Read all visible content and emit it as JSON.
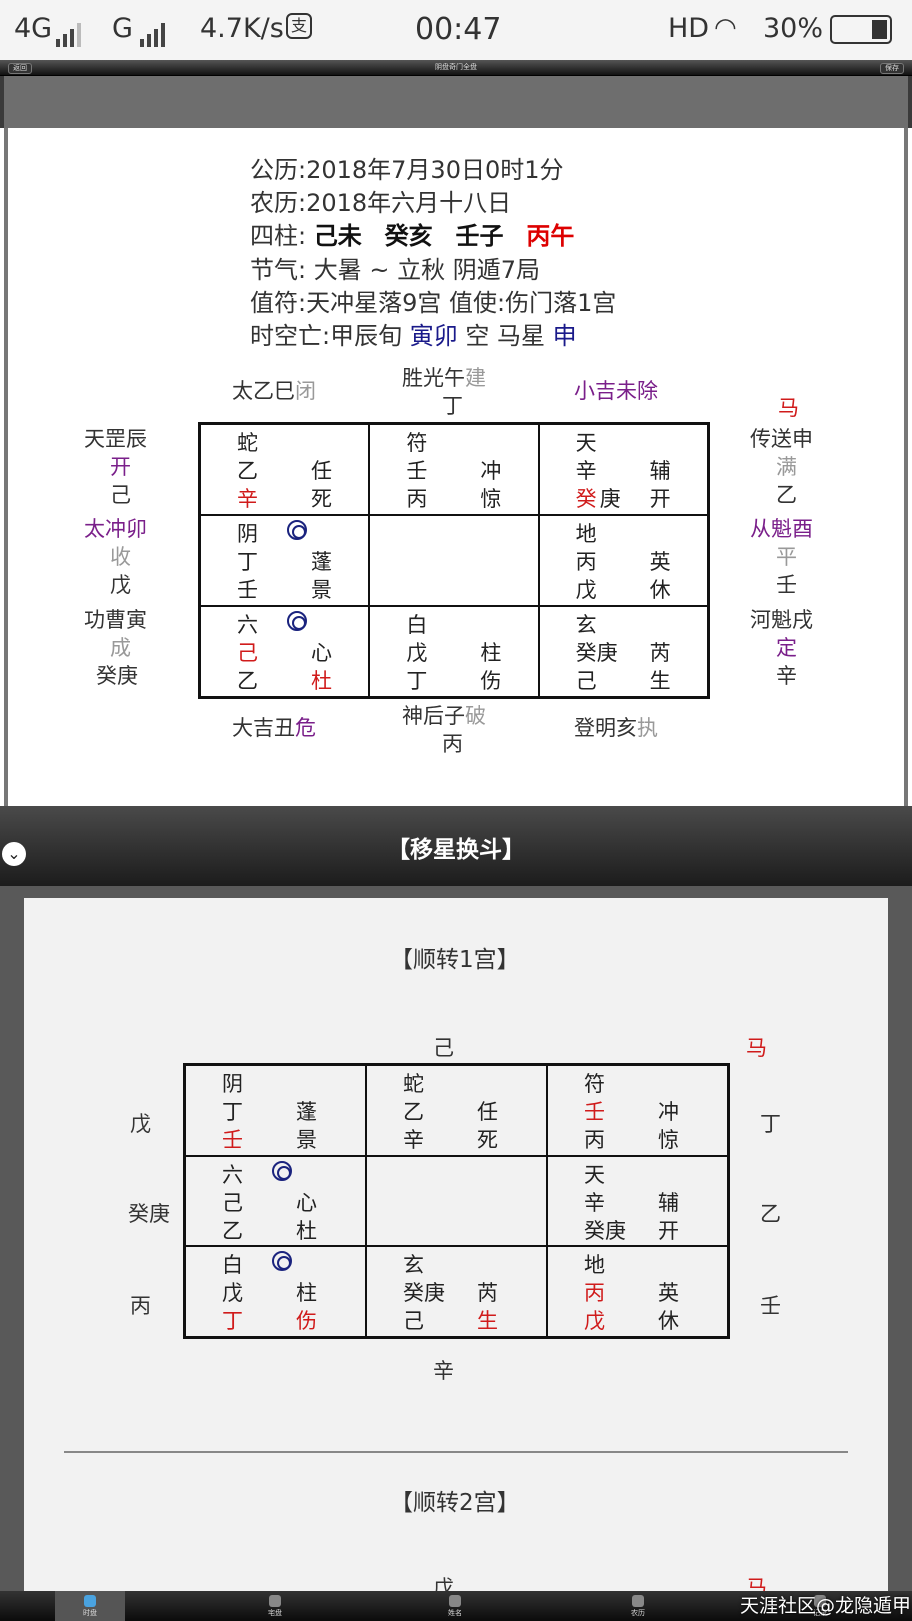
{
  "status": {
    "net1": "4G",
    "net2": "G",
    "speed": "4.7K/s",
    "time": "00:47",
    "hd": "HD",
    "battery": "30%"
  },
  "toolbar": {
    "back_label": "返回",
    "title": "阴盘奇门全盘",
    "save_label": "保存"
  },
  "header": {
    "solar_label": "公历",
    "solar": ":2018年7月30日0时1分",
    "lunar_label": "农历",
    "lunar": ":2018年六月十八日",
    "pillars_label": "四柱:",
    "p1": "己未",
    "p2": "癸亥",
    "p3": "壬子",
    "p4": "丙午",
    "solar_term": "节气: 大暑 ~ 立秋 阴遁7局",
    "zhifu": "值符:天冲星落9宫 值使:伤门落1宫",
    "kong_prefix": "时空亡:甲辰旬",
    "kong_val": "寅卯",
    "kong_mid": "空 马星",
    "ma_val": "申"
  },
  "chart1": {
    "top": {
      "left_a": "太乙巳",
      "left_b": "闭",
      "mid_a": "胜光午",
      "mid_b": "建",
      "mid_c": "丁",
      "right_a": "小吉未",
      "right_b": "除"
    },
    "left": [
      [
        "天罡辰",
        "开",
        "己"
      ],
      [
        "太冲卯",
        "收",
        "戊"
      ],
      [
        "功曹寅",
        "成",
        "癸庚"
      ]
    ],
    "right_ma": "马",
    "right": [
      [
        "传送申",
        "满",
        "乙"
      ],
      [
        "从魁酉",
        "平",
        "壬"
      ],
      [
        "河魁戌",
        "定",
        "辛"
      ]
    ],
    "bottom": {
      "left_a": "大吉丑",
      "left_b": "危",
      "mid_a": "神后子",
      "mid_b": "破",
      "mid_c": "丙",
      "right_a": "登明亥",
      "right_b": "执"
    },
    "cells": [
      {
        "g": "蛇",
        "a": "乙",
        "b": "任",
        "c": "辛",
        "d": "死"
      },
      {
        "g": "符",
        "a": "壬",
        "b": "冲",
        "c": "丙",
        "d": "惊"
      },
      {
        "g": "天",
        "a": "辛",
        "b": "辅",
        "c": "癸",
        "c2": "庚",
        "d": "开"
      },
      {
        "g": "阴",
        "a": "丁",
        "b": "蓬",
        "c": "壬",
        "d": "景"
      },
      {
        "g": "",
        "a": "",
        "b": "",
        "c": "",
        "d": ""
      },
      {
        "g": "地",
        "a": "丙",
        "b": "英",
        "c": "戊",
        "d": "休"
      },
      {
        "g": "六",
        "a": "己",
        "b": "心",
        "c": "乙",
        "d": "杜"
      },
      {
        "g": "白",
        "a": "戊",
        "b": "柱",
        "c": "丁",
        "d": "伤"
      },
      {
        "g": "玄",
        "a": "癸庚",
        "b": "芮",
        "c": "己",
        "d": "生"
      }
    ]
  },
  "section_title": "【移星换斗】",
  "chart2": {
    "title": "【顺转1宫】",
    "top": "己",
    "ma": "马",
    "bottom": "辛",
    "left": [
      "戊",
      "癸庚",
      "丙"
    ],
    "right": [
      "丁",
      "乙",
      "壬"
    ],
    "cells": [
      {
        "g": "阴",
        "a": "丁",
        "b": "蓬",
        "c": "壬",
        "d": "景"
      },
      {
        "g": "蛇",
        "a": "乙",
        "b": "任",
        "c": "辛",
        "d": "死"
      },
      {
        "g": "符",
        "a": "壬",
        "b": "冲",
        "c": "丙",
        "d": "惊"
      },
      {
        "g": "六",
        "a": "己",
        "b": "心",
        "c": "乙",
        "d": "杜"
      },
      {
        "g": "",
        "a": "",
        "b": "",
        "c": "",
        "d": ""
      },
      {
        "g": "天",
        "a": "辛",
        "b": "辅",
        "c": "癸庚",
        "d": "开"
      },
      {
        "g": "白",
        "a": "戊",
        "b": "柱",
        "c": "丁",
        "d": "伤"
      },
      {
        "g": "玄",
        "a": "癸庚",
        "b": "芮",
        "c": "己",
        "d": "生"
      },
      {
        "g": "地",
        "a": "丙",
        "b": "英",
        "c": "戊",
        "d": "休"
      }
    ]
  },
  "chart3": {
    "title": "【顺转2宫】",
    "top": "戊",
    "ma": "马"
  },
  "bottomnav": [
    "时盘",
    "宅盘",
    "姓名",
    "农历",
    "记录"
  ],
  "watermark": "天涯社区@龙隐遁甲"
}
